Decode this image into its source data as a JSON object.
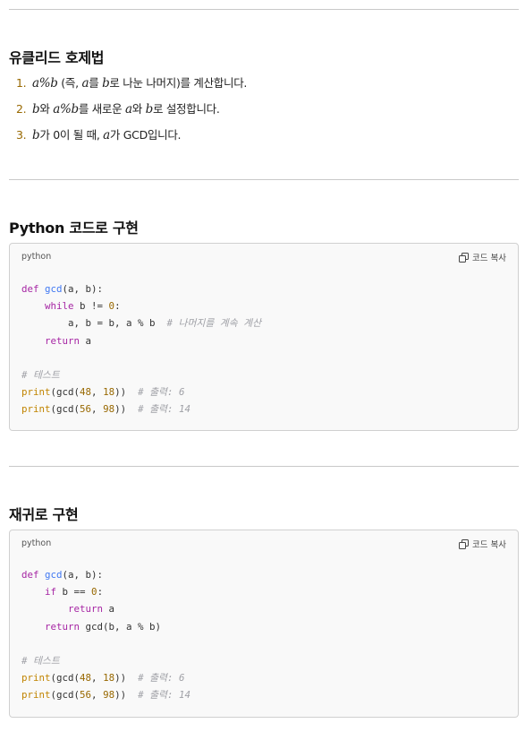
{
  "section1": {
    "title": "유클리드 호제법",
    "steps": [
      {
        "num": "1.",
        "m1": "a%b",
        "text": " (즉, ",
        "m2": "a",
        "text2": "를 ",
        "m3": "b",
        "text3": "로 나눈 나머지)를 계산합니다."
      },
      {
        "num": "2.",
        "m1": "b",
        "text": "와 ",
        "m2": "a%b",
        "text2": "를 새로운 ",
        "m3": "a",
        "text3": "와 ",
        "m4": "b",
        "text4": "로 설정합니다."
      },
      {
        "num": "3.",
        "m1": "b",
        "text": "가 0이 될 때, ",
        "m2": "a",
        "text2": "가 GCD입니다."
      }
    ]
  },
  "section2": {
    "title": "Python 코드로 구현",
    "lang": "python",
    "copy_label": "코드 복사",
    "code": {
      "l1_def": "def",
      "l1_fn": "gcd",
      "l1_rest": "(a, b):",
      "l2_kw": "while",
      "l2_rest": " b != ",
      "l2_num": "0",
      "l2_end": ":",
      "l3_code": "a, b = b, a % b  ",
      "l3_cm": "# 나머지를 계속 계산",
      "l4_kw": "return",
      "l4_rest": " a",
      "l6_cm": "# 테스트",
      "l7_print": "print",
      "l7_a": "(gcd(",
      "l7_n1": "48",
      "l7_b": ", ",
      "l7_n2": "18",
      "l7_c": "))  ",
      "l7_cm": "# 출력: 6",
      "l8_print": "print",
      "l8_a": "(gcd(",
      "l8_n1": "56",
      "l8_b": ", ",
      "l8_n2": "98",
      "l8_c": "))  ",
      "l8_cm": "# 출력: 14"
    }
  },
  "section3": {
    "title": "재귀로 구현",
    "lang": "python",
    "copy_label": "코드 복사",
    "code": {
      "l1_def": "def",
      "l1_fn": "gcd",
      "l1_rest": "(a, b):",
      "l2_kw": "if",
      "l2_rest": " b == ",
      "l2_num": "0",
      "l2_end": ":",
      "l3_kw": "return",
      "l3_rest": " a",
      "l4_kw": "return",
      "l4_rest": " gcd(b, a % b)",
      "l6_cm": "# 테스트",
      "l7_print": "print",
      "l7_a": "(gcd(",
      "l7_n1": "48",
      "l7_b": ", ",
      "l7_n2": "18",
      "l7_c": "))  ",
      "l7_cm": "# 출력: 6",
      "l8_print": "print",
      "l8_a": "(gcd(",
      "l8_n1": "56",
      "l8_b": ", ",
      "l8_n2": "98",
      "l8_c": "))  ",
      "l8_cm": "# 출력: 14"
    }
  }
}
